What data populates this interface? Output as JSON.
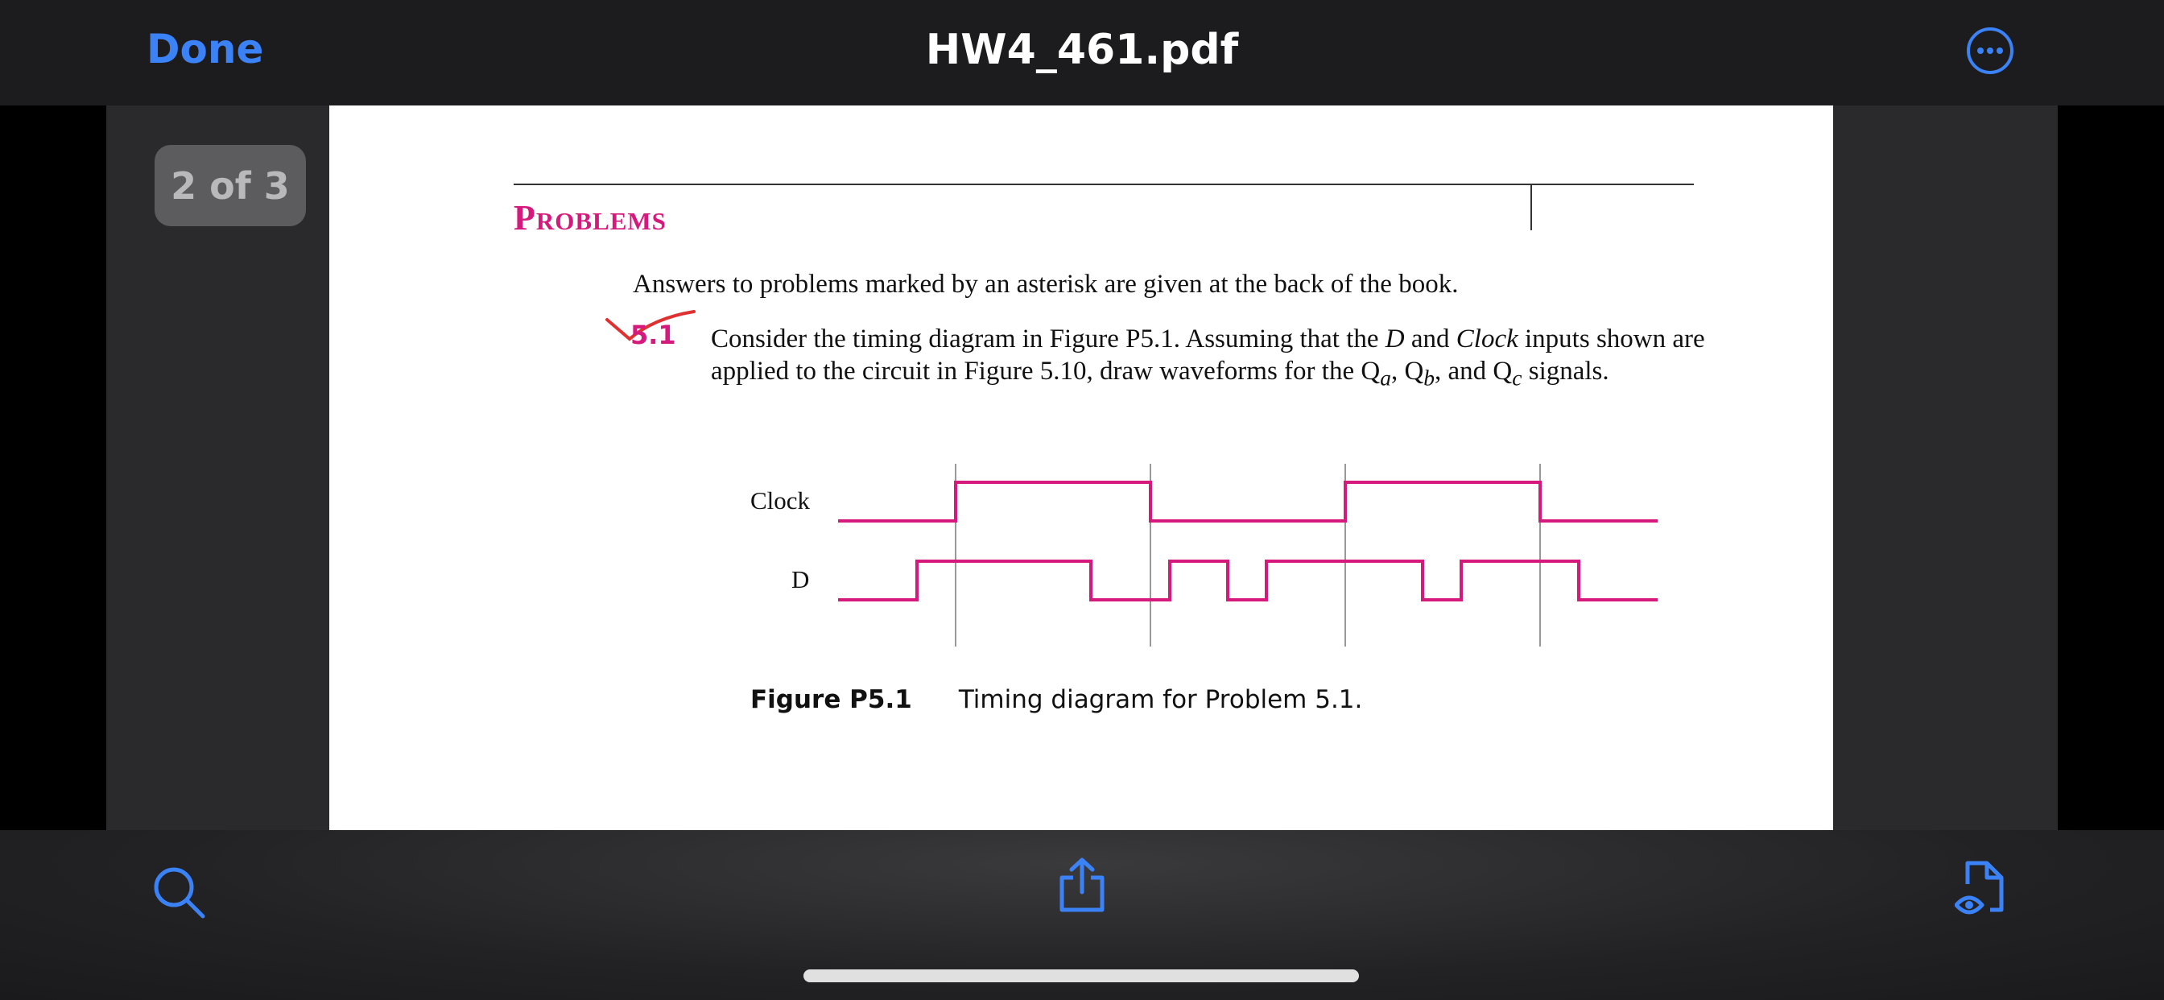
{
  "header": {
    "done_label": "Done",
    "title": "HW4_461.pdf",
    "more_icon": "ellipsis-circle-icon"
  },
  "page_indicator": "2 of 3",
  "document": {
    "section_heading": "Problems",
    "intro": "Answers to problems marked by an asterisk are given at the back of the book.",
    "problem": {
      "number": "5.1",
      "text_1": "Consider the timing diagram in Figure P5.1. Assuming that the ",
      "text_d": "D",
      "text_2": " and ",
      "text_clock": "Clock",
      "text_3": " inputs shown are applied to the circuit in Figure 5.10, draw waveforms for the Q",
      "sub_a": "a",
      "text_4": ", Q",
      "sub_b": "b",
      "text_5": ", and Q",
      "sub_c": "c",
      "text_6": " signals."
    },
    "figure": {
      "clock_label": "Clock",
      "d_label": "D",
      "caption_number": "Figure P5.1",
      "caption_text": "Timing diagram for Problem 5.1."
    }
  },
  "toolbar": {
    "search_icon": "search-icon",
    "share_icon": "share-icon",
    "markup_icon": "document-eye-icon"
  },
  "colors": {
    "accent": "#3b82f6",
    "waveform": "#d6197d",
    "heading": "#d6197d"
  }
}
